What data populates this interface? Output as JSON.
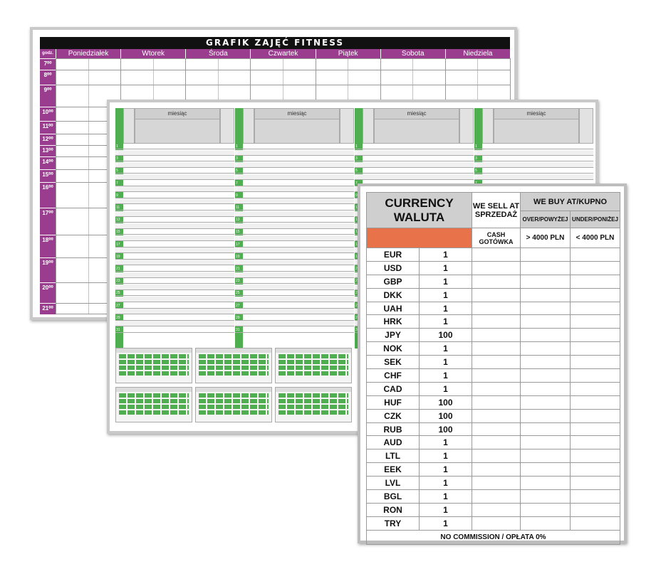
{
  "fitness": {
    "title": "GRAFIK ZAJĘĆ FITNESS",
    "hour_label": "godz.",
    "days": [
      "Poniedziałek",
      "Wtorek",
      "Środa",
      "Czwartek",
      "Piątek",
      "Sobota",
      "Niedziela"
    ],
    "hours": [
      "7⁰⁰",
      "8⁰⁰",
      "9⁰⁰",
      "10⁰⁰",
      "11⁰⁰",
      "12⁰⁰",
      "13⁰⁰",
      "14⁰⁰",
      "15⁰⁰",
      "16⁰⁰",
      "17⁰⁰",
      "18⁰⁰",
      "19⁰⁰",
      "20⁰⁰",
      "21⁰⁰"
    ],
    "header_color": "#9b3d8f"
  },
  "calendar": {
    "month_label": "miesiąc",
    "day_numbers": [
      "1",
      "2",
      "3",
      "4",
      "5",
      "6",
      "7",
      "8",
      "9",
      "10",
      "11",
      "12",
      "13",
      "14",
      "15",
      "16",
      "17",
      "18",
      "19",
      "20",
      "21",
      "22",
      "23",
      "24",
      "25",
      "26",
      "27",
      "28",
      "29",
      "30",
      "31"
    ],
    "accent_color": "#4fae4f"
  },
  "currency": {
    "title_line1": "CURRENCY",
    "title_line2": "WALUTA",
    "sell_header": "WE SELL AT SPRZEDAŻ",
    "buy_header": "WE BUY AT/KUPNO",
    "over_label": "OVER/POWYŻEJ",
    "under_label": "UNDER/PONIŻEJ",
    "cash_label": "CASH GOTÓWKA",
    "over_amount": "> 4000 PLN",
    "under_amount": "< 4000 PLN",
    "accent_color": "#e8734a",
    "rows": [
      {
        "code": "EUR",
        "unit": "1"
      },
      {
        "code": "USD",
        "unit": "1"
      },
      {
        "code": "GBP",
        "unit": "1"
      },
      {
        "code": "DKK",
        "unit": "1"
      },
      {
        "code": "UAH",
        "unit": "1"
      },
      {
        "code": "HRK",
        "unit": "1"
      },
      {
        "code": "JPY",
        "unit": "100"
      },
      {
        "code": "NOK",
        "unit": "1"
      },
      {
        "code": "SEK",
        "unit": "1"
      },
      {
        "code": "CHF",
        "unit": "1"
      },
      {
        "code": "CAD",
        "unit": "1"
      },
      {
        "code": "HUF",
        "unit": "100"
      },
      {
        "code": "CZK",
        "unit": "100"
      },
      {
        "code": "RUB",
        "unit": "100"
      },
      {
        "code": "AUD",
        "unit": "1"
      },
      {
        "code": "LTL",
        "unit": "1"
      },
      {
        "code": "EEK",
        "unit": "1"
      },
      {
        "code": "LVL",
        "unit": "1"
      },
      {
        "code": "BGL",
        "unit": "1"
      },
      {
        "code": "RON",
        "unit": "1"
      },
      {
        "code": "TRY",
        "unit": "1"
      }
    ],
    "footer": "NO COMMISSION / OPŁATA 0%"
  }
}
